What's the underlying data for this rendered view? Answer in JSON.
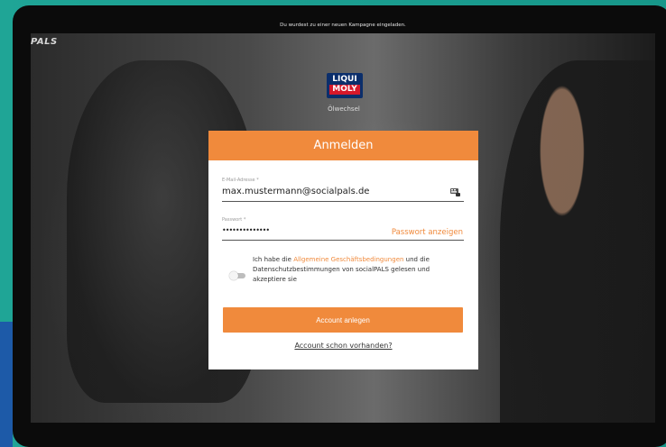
{
  "brand": {
    "name": "PALS"
  },
  "header": {
    "topline": "Du wurdest zu einer neuen Kampagne eingeladen.",
    "logo_line1": "LIQUI",
    "logo_line2": "MOLY",
    "tagline": "Ölwechsel"
  },
  "form": {
    "title": "Anmelden",
    "email_label": "E-Mail-Adresse *",
    "email_value": "max.mustermann@socialpals.de",
    "password_label": "Passwort *",
    "password_value": "••••••••••••••",
    "password_toggle": "Passwort anzeigen",
    "terms_prefix": "Ich habe die ",
    "terms_link": "Allgemeine Geschäftsbedingungen",
    "terms_suffix": " und die Datenschutzbestimmungen von socialPALS gelesen und akzeptiere sie",
    "submit_label": "Account anlegen",
    "existing_account": "Account schon vorhanden?"
  },
  "colors": {
    "accent": "#f08a3c",
    "background": "#1a9e8e",
    "logo_blue": "#0b2e6b",
    "logo_red": "#d7182a"
  },
  "icons": {
    "keyboard": "keyboard-icon"
  }
}
